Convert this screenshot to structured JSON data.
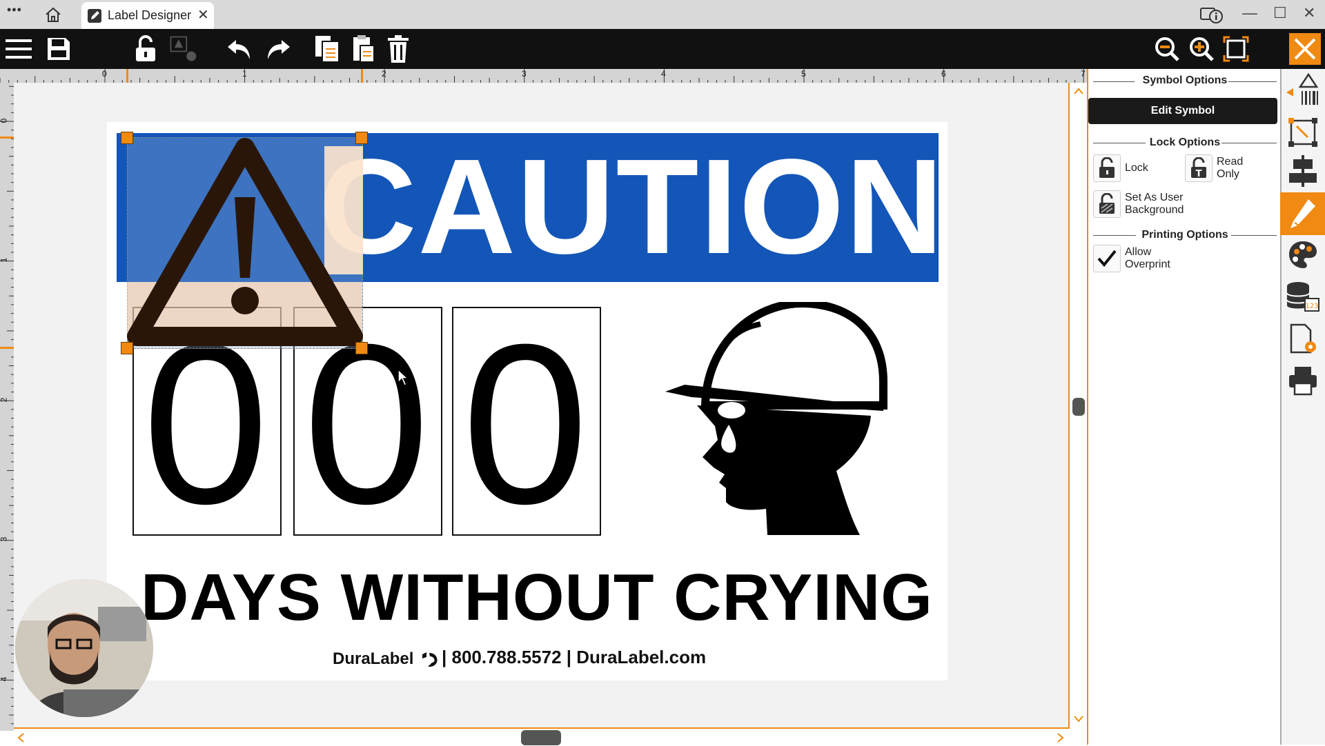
{
  "window": {
    "more_glyph": "•••",
    "tab_title": "Label Designer",
    "tab_close": "✕",
    "minimize": "—",
    "maximize": "☐",
    "close": "✕"
  },
  "ruler": {
    "h_labels": [
      "0",
      "1",
      "2",
      "3",
      "4",
      "5",
      "6",
      "7"
    ],
    "v_labels": [
      "0",
      "1",
      "2",
      "3",
      "4"
    ]
  },
  "label": {
    "banner_text": "CAUTION",
    "digits": [
      "0",
      "0",
      "0"
    ],
    "headline": "DAYS WITHOUT CRYING",
    "footer_brand": "DuraLabel",
    "footer_contact": "| 800.788.5572 | DuraLabel.com"
  },
  "panel": {
    "symbol_options_title": "Symbol Options",
    "edit_symbol_label": "Edit Symbol",
    "lock_options_title": "Lock Options",
    "lock_label": "Lock",
    "read_only_label_1": "Read",
    "read_only_label_2": "Only",
    "user_bg_label_1": "Set As User",
    "user_bg_label_2": "Background",
    "printing_options_title": "Printing Options",
    "overprint_label_1": "Allow",
    "overprint_label_2": "Overprint",
    "overprint_checked": true
  },
  "colors": {
    "accent": "#f08a12",
    "banner": "#1356b8",
    "toolbar": "#111111"
  }
}
